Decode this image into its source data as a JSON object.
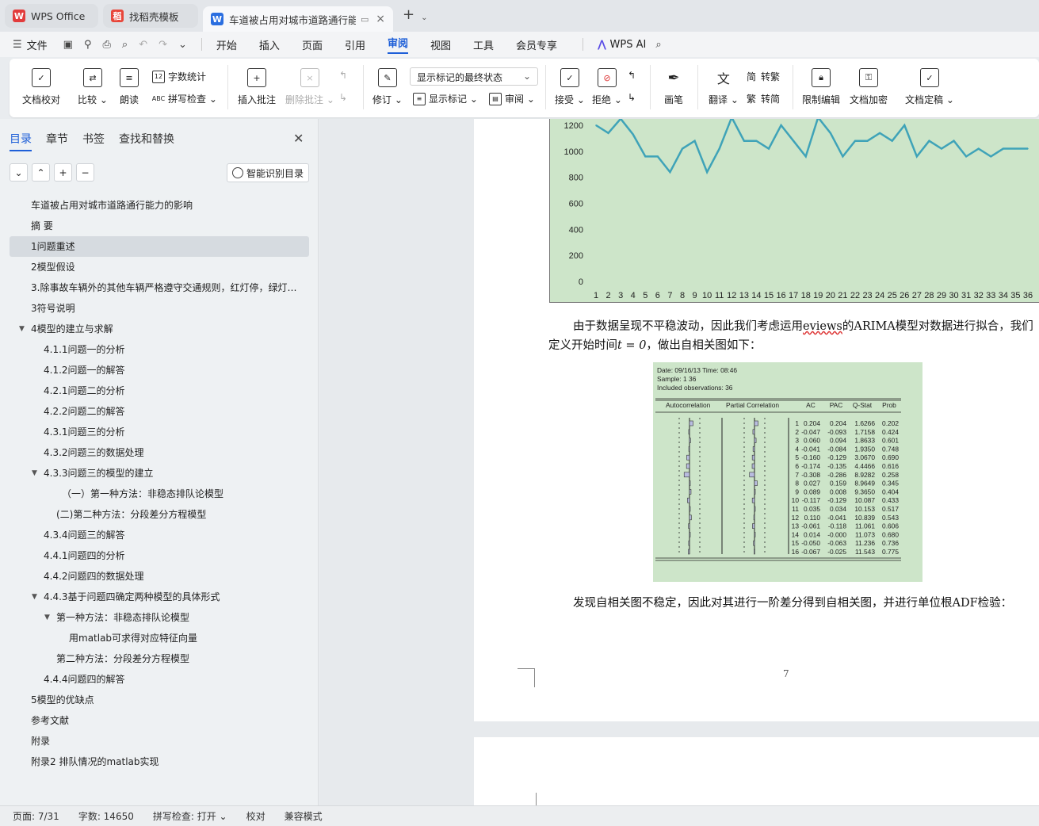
{
  "tabs": [
    {
      "label": "WPS Office",
      "icon": "wps-logo-icon"
    },
    {
      "label": "找稻壳模板",
      "icon": "docer-icon"
    },
    {
      "label": "车道被占用对城市道路通行能力",
      "icon": "writer-doc-icon"
    }
  ],
  "menu": {
    "file": "文件",
    "items": [
      "开始",
      "插入",
      "页面",
      "引用",
      "审阅",
      "视图",
      "工具",
      "会员专享"
    ],
    "active": "审阅",
    "wps_ai": "WPS AI"
  },
  "ribbon": {
    "doc_proofread": "文档校对",
    "compare": "比较",
    "read_aloud": "朗读",
    "word_count": "字数统计",
    "spell_check": "拼写检查",
    "insert_comment": "插入批注",
    "delete_comment": "删除批注",
    "revise": "修订",
    "markup_state": "显示标记的最终状态",
    "show_markup": "显示标记",
    "review": "审阅",
    "accept": "接受",
    "reject": "拒绝",
    "pen": "画笔",
    "translate": "翻译",
    "to_traditional": "转繁",
    "to_simplified": "转简",
    "restrict_edit": "限制编辑",
    "encrypt": "文档加密",
    "finalize": "文档定稿"
  },
  "sidebar": {
    "tabs": [
      "目录",
      "章节",
      "书签",
      "查找和替换"
    ],
    "smart_toc": "智能识别目录",
    "toc": [
      {
        "label": "车道被占用对城市道路通行能力的影响",
        "level": 1
      },
      {
        "label": "摘  要",
        "level": 1
      },
      {
        "label": "1问题重述",
        "level": 1,
        "selected": true
      },
      {
        "label": "2模型假设",
        "level": 1
      },
      {
        "label": "3.除事故车辆外的其他车辆严格遵守交通规则，红灯停，绿灯行。",
        "level": 1
      },
      {
        "label": "3符号说明",
        "level": 1
      },
      {
        "label": "4模型的建立与求解",
        "level": 1,
        "expanded": true
      },
      {
        "label": "4.1.1问题一的分析",
        "level": 2
      },
      {
        "label": "4.1.2问题一的解答",
        "level": 2
      },
      {
        "label": "4.2.1问题二的分析",
        "level": 2
      },
      {
        "label": "4.2.2问题二的解答",
        "level": 2
      },
      {
        "label": "4.3.1问题三的分析",
        "level": 2
      },
      {
        "label": "4.3.2问题三的数据处理",
        "level": 2
      },
      {
        "label": "4.3.3问题三的模型的建立",
        "level": 2,
        "expanded": true
      },
      {
        "label": "（一）第一种方法：非稳态排队论模型",
        "level": 3
      },
      {
        "label": "(二)第二种方法：分段差分方程模型",
        "level": 3
      },
      {
        "label": "4.3.4问题三的解答",
        "level": 2
      },
      {
        "label": "4.4.1问题四的分析",
        "level": 2
      },
      {
        "label": "4.4.2问题四的数据处理",
        "level": 2
      },
      {
        "label": "4.4.3基于问题四确定两种模型的具体形式",
        "level": 2,
        "expanded": true
      },
      {
        "label": "第一种方法：非稳态排队论模型",
        "level": 3,
        "expanded": true
      },
      {
        "label": "用matlab可求得对应特征向量",
        "level": 4
      },
      {
        "label": "第二种方法：分段差分方程模型",
        "level": 3
      },
      {
        "label": "4.4.4问题四的解答",
        "level": 2
      },
      {
        "label": "5模型的优缺点",
        "level": 1
      },
      {
        "label": "参考文献",
        "level": 1
      },
      {
        "label": "附录",
        "level": 1
      },
      {
        "label": "附录2 排队情况的matlab实现",
        "level": 1
      }
    ]
  },
  "document": {
    "para1": "由于数据呈现不平稳波动，因此我们考虑运用eviews的ARIMA模型对数据进行拟合，我们定义开始时间t = 0，做出自相关图如下：",
    "para1_parts": [
      "由于数据呈现不平稳波动，因此我们考虑运用",
      "eviews",
      "的ARIMA模型对数据进行拟合，我们定义开始时间",
      "t = 0",
      "，做出自相关图如下："
    ],
    "para2": "发现自相关图不稳定，因此对其进行一阶差分得到自相关图，并进行单位根ADF检验：",
    "page_number": "7"
  },
  "chart_data": {
    "type": "line",
    "x": [
      1,
      2,
      3,
      4,
      5,
      6,
      7,
      8,
      9,
      10,
      11,
      12,
      13,
      14,
      15,
      16,
      17,
      18,
      19,
      20,
      21,
      22,
      23,
      24,
      25,
      26,
      27,
      28,
      29,
      30,
      31,
      32,
      33,
      34,
      35,
      36
    ],
    "series": [
      {
        "values": [
          1200,
          1140,
          1250,
          1130,
          960,
          960,
          840,
          1020,
          1080,
          840,
          1020,
          1260,
          1080,
          1080,
          1020,
          1200,
          1080,
          960,
          1260,
          1140,
          960,
          1080,
          1080,
          1140,
          1080,
          1200,
          960,
          1080,
          1020,
          1080,
          960,
          1020,
          960,
          1020,
          1020,
          1020
        ]
      }
    ],
    "ylim": [
      0,
      1200
    ],
    "yticks": [
      0,
      200,
      400,
      600,
      800,
      1000,
      1200
    ],
    "line_color": "#3fa3b8",
    "background": "#cde5c9"
  },
  "eviews": {
    "header": [
      "Date: 09/16/13   Time: 08:46",
      "Sample: 1 36",
      "Included observations: 36"
    ],
    "columns": [
      "Autocorrelation",
      "Partial Correlation",
      "AC",
      "PAC",
      "Q-Stat",
      "Prob"
    ],
    "rows": [
      [
        "1",
        "0.204",
        "0.204",
        "1.6266",
        "0.202"
      ],
      [
        "2",
        "-0.047",
        "-0.093",
        "1.7158",
        "0.424"
      ],
      [
        "3",
        "0.060",
        "0.094",
        "1.8633",
        "0.601"
      ],
      [
        "4",
        "-0.041",
        "-0.084",
        "1.9350",
        "0.748"
      ],
      [
        "5",
        "-0.160",
        "-0.129",
        "3.0670",
        "0.690"
      ],
      [
        "6",
        "-0.174",
        "-0.135",
        "4.4466",
        "0.616"
      ],
      [
        "7",
        "-0.308",
        "-0.286",
        "8.9282",
        "0.258"
      ],
      [
        "8",
        "0.027",
        "0.159",
        "8.9649",
        "0.345"
      ],
      [
        "9",
        "0.089",
        "0.008",
        "9.3650",
        "0.404"
      ],
      [
        "10",
        "-0.117",
        "-0.129",
        "10.087",
        "0.433"
      ],
      [
        "11",
        "0.035",
        "0.034",
        "10.153",
        "0.517"
      ],
      [
        "12",
        "0.110",
        "-0.041",
        "10.839",
        "0.543"
      ],
      [
        "13",
        "-0.061",
        "-0.118",
        "11.061",
        "0.606"
      ],
      [
        "14",
        "0.014",
        "-0.000",
        "11.073",
        "0.680"
      ],
      [
        "15",
        "-0.050",
        "-0.063",
        "11.236",
        "0.736"
      ],
      [
        "16",
        "-0.067",
        "-0.025",
        "11.543",
        "0.775"
      ]
    ]
  },
  "status": {
    "page": "页面: 7/31",
    "words": "字数: 14650",
    "spell": "拼写检查: 打开",
    "proofread": "校对",
    "compat": "兼容模式"
  }
}
